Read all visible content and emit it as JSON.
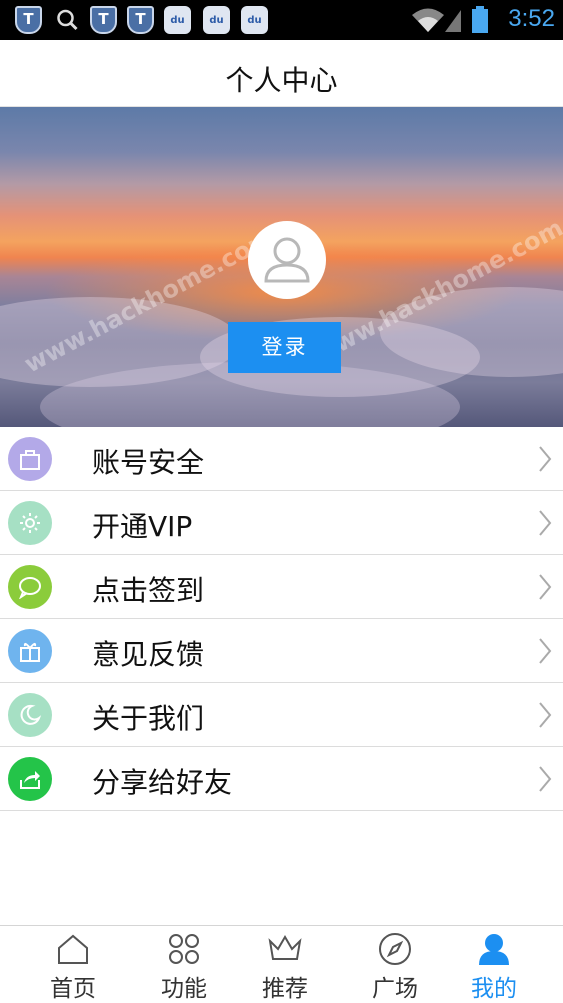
{
  "status_bar": {
    "time": "3:52",
    "icons": [
      "shield-icon",
      "search-icon",
      "shield-sim-icon",
      "shield-icon",
      "baidu-paw-icon",
      "baidu-paw-icon",
      "baidu-paw-icon",
      "wifi-icon",
      "signal-icon",
      "battery-icon"
    ],
    "time_color": "#4aa8f0"
  },
  "header": {
    "title": "个人中心"
  },
  "hero": {
    "watermark": "www.hackhome.com",
    "login_label": "登录",
    "avatar_icon": "user-avatar-icon",
    "button_color": "#1c8ff1"
  },
  "menu": {
    "items": [
      {
        "label": "账号安全",
        "icon": "bag-icon",
        "color": "#b3a9e8"
      },
      {
        "label": "开通VIP",
        "icon": "sun-icon",
        "color": "#a6e0c4"
      },
      {
        "label": "点击签到",
        "icon": "chat-bubble-icon",
        "color": "#8bcc3b"
      },
      {
        "label": "意见反馈",
        "icon": "gift-icon",
        "color": "#6fb4ee"
      },
      {
        "label": "关于我们",
        "icon": "moon-icon",
        "color": "#a6e0c4"
      },
      {
        "label": "分享给好友",
        "icon": "share-icon",
        "color": "#24c449"
      }
    ]
  },
  "tabbar": {
    "tabs": [
      {
        "label": "首页",
        "icon": "home-icon"
      },
      {
        "label": "功能",
        "icon": "grid-icon"
      },
      {
        "label": "推荐",
        "icon": "crown-icon"
      },
      {
        "label": "广场",
        "icon": "compass-icon"
      },
      {
        "label": "我的",
        "icon": "person-icon",
        "active": true
      }
    ],
    "active_color": "#1c8ff1"
  }
}
